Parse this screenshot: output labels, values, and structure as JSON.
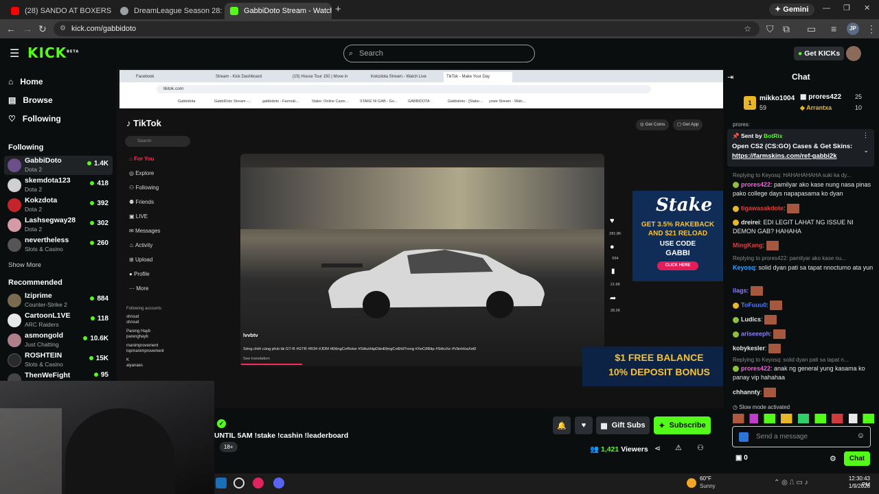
{
  "browser": {
    "tabs": [
      {
        "label": "(28) SANDO AT BOXERS - YouTube",
        "color": "#ff0000"
      },
      {
        "label": "DreamLeague Season 28: South",
        "color": "#9aa0a6"
      },
      {
        "label": "GabbiDoto Stream - Watch",
        "color": "#53fc18"
      }
    ],
    "gemini_label": "Gemini",
    "url": "kick.com/gabbidoto",
    "profile_initials": "JP"
  },
  "kick": {
    "logo": "KICK",
    "logo_sup": "BETA",
    "search_placeholder": "Search",
    "get_kicks_label": "Get KICKs"
  },
  "sidebar": {
    "nav": [
      {
        "label": "Home",
        "icon": "home-icon"
      },
      {
        "label": "Browse",
        "icon": "browse-icon"
      },
      {
        "label": "Following",
        "icon": "heart-icon"
      }
    ],
    "following_header": "Following",
    "following": [
      {
        "name": "GabbiDoto",
        "game": "Dota 2",
        "viewers": "1.4K",
        "color": "#6b4f8a"
      },
      {
        "name": "skemdota123",
        "game": "Dota 2",
        "viewers": "418",
        "color": "#d0d0d0"
      },
      {
        "name": "Kokzdota",
        "game": "Dota 2",
        "viewers": "392",
        "color": "#c4252b"
      },
      {
        "name": "Lashsegway28",
        "game": "Dota 2",
        "viewers": "302",
        "color": "#d49aa6"
      },
      {
        "name": "nevertheless",
        "game": "Slots & Casino",
        "viewers": "260",
        "color": "#555555"
      }
    ],
    "show_more": "Show More",
    "recommended_header": "Recommended",
    "recommended": [
      {
        "name": "Iziprime",
        "game": "Counter-Strike 2",
        "viewers": "884",
        "color": "#7a6a50"
      },
      {
        "name": "CartoonL1VE",
        "game": "ARC Raiders",
        "viewers": "118",
        "color": "#e8e8e8"
      },
      {
        "name": "asmongold",
        "game": "Just Chatting",
        "viewers": "10.6K",
        "color": "#b0808a"
      },
      {
        "name": "ROSHTEIN",
        "game": "Slots & Casino",
        "viewers": "15K",
        "color": "#2a2a2a"
      },
      {
        "name": "ThenWeFight",
        "game": "",
        "viewers": "95",
        "color": "#444444"
      }
    ]
  },
  "video": {
    "inner_tabs": [
      "Facebook",
      "Stream - Kick Dashboard",
      "(15) House Tour 150 | Move in",
      "Kokzdota Stream - Watch Live",
      "TikTok - Make Your Day"
    ],
    "inner_url": "tiktok.com",
    "bookmarks": [
      "Gabbidota",
      "GabbiDoto Stream -...",
      "gabbidoto - Farmski...",
      "Stake: Online Casin...",
      "STAKE NI GAB - Go...",
      "GABBIDOTA",
      "Gabbidoto - [Stake...",
      "yowe Stream - Watc..."
    ],
    "tiktok": {
      "logo": "TikTok",
      "search_placeholder": "Search",
      "get_coins": "Get Coins",
      "get_app": "Get App",
      "nav": [
        "For You",
        "Explore",
        "Following",
        "Friends",
        "LIVE",
        "Messages",
        "Activity",
        "Upload",
        "Profile",
        "More"
      ],
      "following_accounts_header": "Following accounts",
      "accounts": [
        {
          "name": "shroud",
          "handle": "shroud"
        },
        {
          "name": "Pareng Hayb",
          "handle": "parenghayb"
        },
        {
          "name": "manimprovement",
          "handle": "topmanimprovement"
        },
        {
          "name": "K",
          "handle": "aiyanaes"
        }
      ],
      "author": "lvvbtv",
      "caption": "Sống chết cùng phái lái GT-R #GTR #R34 #JDM #ĐộngCơRotor #SiêuHấpDẫnĐộngCơĐốiTrong #XeCổBắp #SiêuXe #VănHóaXeĐ",
      "see_translation": "See translation",
      "action_counts": [
        "281.8K",
        "554",
        "21.6K",
        "28.2K"
      ]
    },
    "stake_ad": {
      "brand": "Stake",
      "line1": "GET 3.5% RAKEBACK",
      "line2": "AND $21 RELOAD",
      "use_code": "USE CODE",
      "code": "GABBI",
      "cta": "CLICK HERE"
    },
    "bonus_ad": {
      "line1": "$1 FREE BALANCE",
      "line2": "10% DEPOSIT BONUS"
    }
  },
  "stream": {
    "title": "UNTIL 5AM !stake !cashin !leaderboard",
    "age_tag": "18+",
    "gift_subs": "Gift Subs",
    "subscribe": "Subscribe",
    "viewers": "1,421",
    "viewers_label": "Viewers"
  },
  "chat": {
    "title": "Chat",
    "leaderboard": [
      {
        "rank": "1",
        "name": "mikko1004",
        "value": "59"
      },
      {
        "name": "prores422",
        "value": "25"
      },
      {
        "name": "Arrantxa",
        "value": "10"
      }
    ],
    "pinned_top": "prores:",
    "pinned": {
      "sent_by": "Sent by",
      "bot": "BotRix",
      "text": "Open CS2 (CS:GO) Cases & Get Skins:",
      "link": "https://farmskins.com/ref-gabbi2k"
    },
    "messages": [
      {
        "reply": "Replying to Keyosq: HAHAHAHAHA suki ka dy..."
      },
      {
        "user": "prores422",
        "color": "#f25fe1",
        "text": "pamilyar ako kase nung nasa pinas pako college days napapasama ko dyan"
      },
      {
        "user": "tigawasakdote",
        "color": "#f03838",
        "text": "",
        "emote": true
      },
      {
        "user": "dreirei",
        "color": "#e9e9e9",
        "text": "EDI LEGIT LAHAT NG ISSUE NI DEMON GAB? HAHAHA"
      },
      {
        "user": "MingKang",
        "color": "#f03838",
        "text": "",
        "emote": true
      },
      {
        "reply": "Replying to prores422: pamilyar ako kase nu..."
      },
      {
        "user": "Keyosq",
        "color": "#2fa4ff",
        "text": "solid dyan pati sa tapat nnocturno ata yun"
      },
      {
        "user": "ilags",
        "color": "#8d7bff",
        "text": "",
        "emote": true
      },
      {
        "user": "ToFuuu0",
        "color": "#4b7bff",
        "text": "",
        "emote": true
      },
      {
        "user": "Ludics",
        "color": "#e9e9e9",
        "text": "",
        "emote": true
      },
      {
        "user": "ariseeeph",
        "color": "#8d7bff",
        "text": "",
        "emote": true
      },
      {
        "user": "kobykesler",
        "color": "#e9e9e9",
        "text": "",
        "emote": true
      },
      {
        "reply": "Replying to Keyosq: solid dyan pati sa tapat n..."
      },
      {
        "user": "prores422",
        "color": "#f25fe1",
        "text": "anak ng general yung kasama ko panay vip hahahaa"
      },
      {
        "user": "chhannty",
        "color": "#e9e9e9",
        "text": "",
        "emote": true
      }
    ],
    "slow_mode": "Slow mode activated",
    "input_placeholder": "Send a message",
    "kicks_count": "0",
    "send_label": "Chat"
  },
  "taskbar": {
    "temperature": "60°F",
    "weather": "Sunny",
    "time": "12:30:43 PM",
    "date": "1/9/2026"
  }
}
